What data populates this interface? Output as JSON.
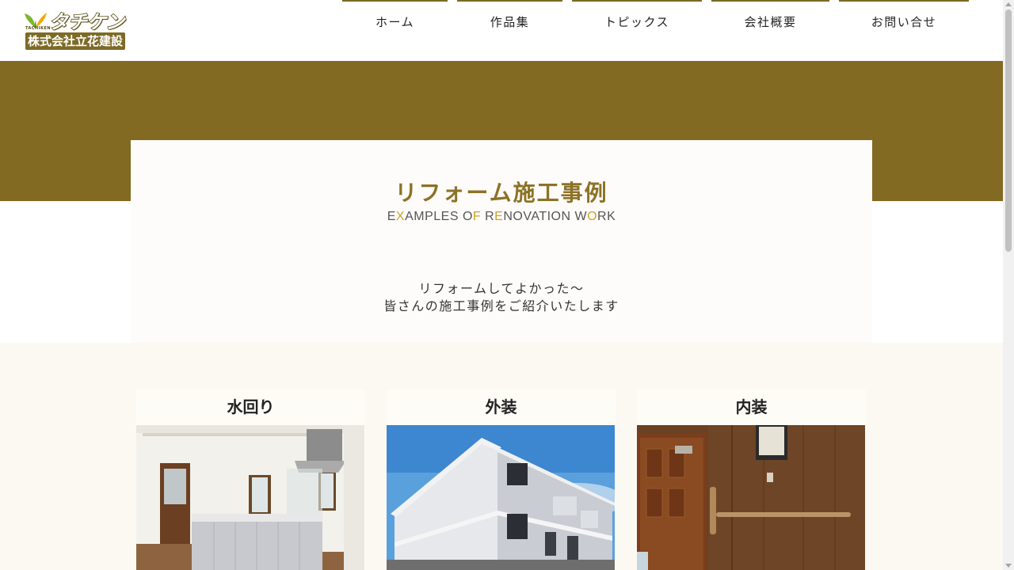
{
  "header": {
    "logo": {
      "brand_katakana": "タチケン",
      "brand_romaji": "TACHIKEN",
      "company_name": "株式会社立花建設"
    },
    "nav": [
      {
        "label": "ホーム"
      },
      {
        "label": "作品集"
      },
      {
        "label": "トピックス"
      },
      {
        "label": "会社概要"
      },
      {
        "label": "お問い合せ"
      }
    ]
  },
  "hero": {
    "title": "リフォーム施工事例",
    "subtitle_parts": [
      "E",
      "X",
      "AMPLES O",
      "F",
      " R",
      "E",
      "NOVATION W",
      "O",
      "RK"
    ],
    "intro_line1": "リフォームしてよかった〜",
    "intro_line2": "皆さんの施工事例をご紹介いたします"
  },
  "categories": [
    {
      "title": "水回り",
      "image": "kitchen-photo"
    },
    {
      "title": "外装",
      "image": "apartment-exterior-photo"
    },
    {
      "title": "内装",
      "image": "wooden-door-interior-photo"
    }
  ],
  "colors": {
    "brand_band": "#836a22",
    "title_gold": "#8c7226",
    "accent_yellow": "#c9a227",
    "nav_border": "#7a6a24",
    "section_bg": "#fcf9f3"
  }
}
